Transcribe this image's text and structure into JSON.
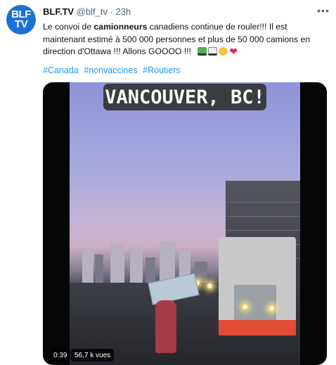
{
  "tweet": {
    "display_name": "BLF.TV",
    "handle": "@blf_tv",
    "separator": "·",
    "time": "23h",
    "avatar": {
      "line1": "BLF",
      "line2": "TV"
    },
    "text": {
      "part1": "Le convoi de ",
      "bold": "camionneurs",
      "part2": " canadiens continue de rouler!!! Il est maintenant estimé à 500 000 personnes et plus de 50 000 camions en direction d'Ottawa !!! Allons GOOOO !!!"
    },
    "emojis": [
      "truck-emoji",
      "truck-emoji",
      "fist-emoji",
      "heart-emoji"
    ],
    "hashtags": [
      "#Canada",
      "#nonvaccines",
      "#Routiers"
    ],
    "more_icon": "more-icon"
  },
  "media": {
    "overlay_text": "VANCOUVER, BC!",
    "duration": "0:39",
    "views": "56,7 k vues"
  },
  "colors": {
    "link": "#1d9bf0",
    "avatar_bg": "#1d6fd8",
    "text": "#0f1419",
    "muted": "#536471"
  }
}
